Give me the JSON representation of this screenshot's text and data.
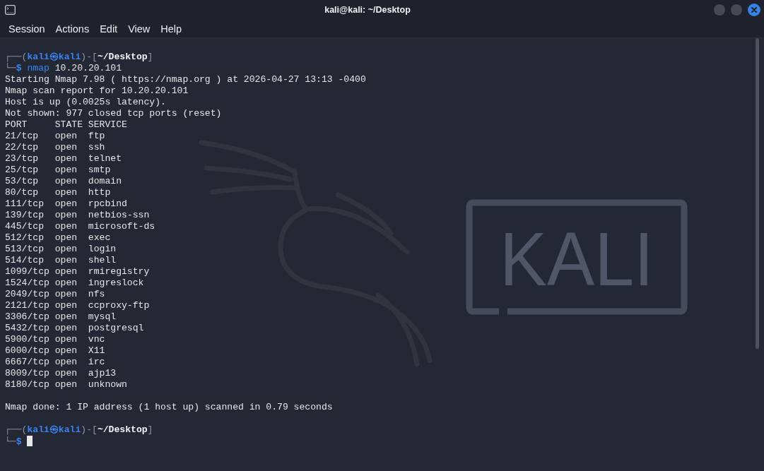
{
  "window": {
    "title": "kali@kali: ~/Desktop"
  },
  "menu": [
    "Session",
    "Actions",
    "Edit",
    "View",
    "Help"
  ],
  "terminal": {
    "blocks": [
      {
        "kind": "prompt",
        "frame_open": "┌──(",
        "user_host": "kali㉿kali",
        "frame_mid": ")-[",
        "cwd": "~/Desktop",
        "frame_close": "]",
        "lead": "└─",
        "sign": "$",
        "command": "nmap",
        "args": "10.20.20.101",
        "cursor": false
      },
      {
        "kind": "output",
        "lines": [
          "Starting Nmap 7.98 ( https://nmap.org ) at 2026-04-27 13:13 -0400",
          "Nmap scan report for 10.20.20.101",
          "Host is up (0.0025s latency).",
          "Not shown: 977 closed tcp ports (reset)"
        ]
      },
      {
        "kind": "port_table",
        "columns": [
          "PORT",
          "STATE",
          "SERVICE"
        ],
        "rows": [
          {
            "port": "21/tcp",
            "state": "open",
            "service": "ftp"
          },
          {
            "port": "22/tcp",
            "state": "open",
            "service": "ssh"
          },
          {
            "port": "23/tcp",
            "state": "open",
            "service": "telnet"
          },
          {
            "port": "25/tcp",
            "state": "open",
            "service": "smtp"
          },
          {
            "port": "53/tcp",
            "state": "open",
            "service": "domain"
          },
          {
            "port": "80/tcp",
            "state": "open",
            "service": "http"
          },
          {
            "port": "111/tcp",
            "state": "open",
            "service": "rpcbind"
          },
          {
            "port": "139/tcp",
            "state": "open",
            "service": "netbios-ssn"
          },
          {
            "port": "445/tcp",
            "state": "open",
            "service": "microsoft-ds"
          },
          {
            "port": "512/tcp",
            "state": "open",
            "service": "exec"
          },
          {
            "port": "513/tcp",
            "state": "open",
            "service": "login"
          },
          {
            "port": "514/tcp",
            "state": "open",
            "service": "shell"
          },
          {
            "port": "1099/tcp",
            "state": "open",
            "service": "rmiregistry"
          },
          {
            "port": "1524/tcp",
            "state": "open",
            "service": "ingreslock"
          },
          {
            "port": "2049/tcp",
            "state": "open",
            "service": "nfs"
          },
          {
            "port": "2121/tcp",
            "state": "open",
            "service": "ccproxy-ftp"
          },
          {
            "port": "3306/tcp",
            "state": "open",
            "service": "mysql"
          },
          {
            "port": "5432/tcp",
            "state": "open",
            "service": "postgresql"
          },
          {
            "port": "5900/tcp",
            "state": "open",
            "service": "vnc"
          },
          {
            "port": "6000/tcp",
            "state": "open",
            "service": "X11"
          },
          {
            "port": "6667/tcp",
            "state": "open",
            "service": "irc"
          },
          {
            "port": "8009/tcp",
            "state": "open",
            "service": "ajp13"
          },
          {
            "port": "8180/tcp",
            "state": "open",
            "service": "unknown"
          }
        ]
      },
      {
        "kind": "summary",
        "lines": [
          "Nmap done: 1 IP address (1 host up) scanned in 0.79 seconds"
        ]
      },
      {
        "kind": "prompt",
        "frame_open": "┌──(",
        "user_host": "kali㉿kali",
        "frame_mid": ")-[",
        "cwd": "~/Desktop",
        "frame_close": "]",
        "lead": "└─",
        "sign": "$",
        "cursor": true
      }
    ]
  },
  "wallpaper": {
    "logo_text": "KALI"
  }
}
